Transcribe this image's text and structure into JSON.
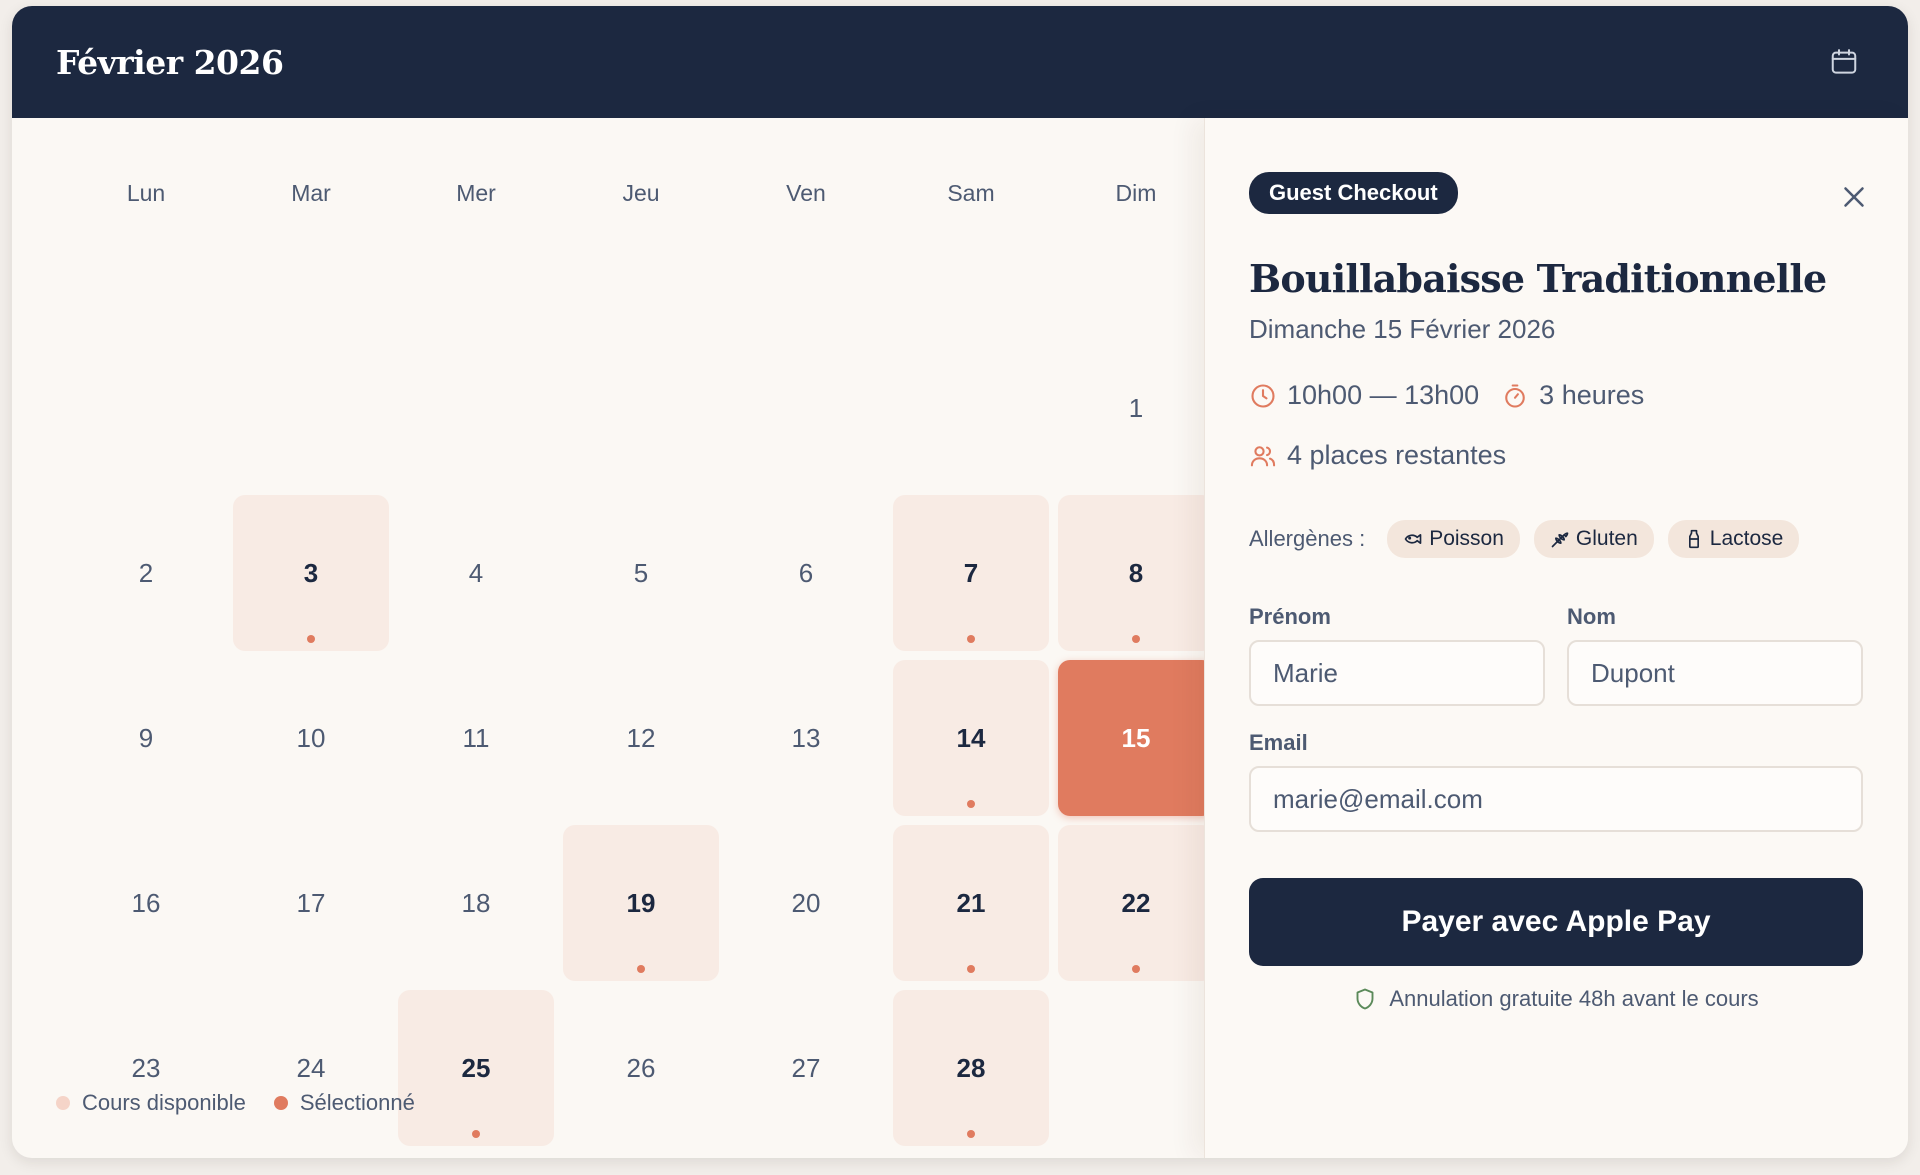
{
  "header": {
    "month_title": "Février 2026",
    "calendar_icon": "calendar-icon"
  },
  "calendar": {
    "weekdays": [
      "Lun",
      "Mar",
      "Mer",
      "Jeu",
      "Ven",
      "Sam",
      "Dim"
    ],
    "first_weekday_index": 6,
    "days_in_month": 28,
    "available_days": [
      3,
      7,
      8,
      14,
      19,
      21,
      22,
      25,
      28
    ],
    "selected_day": 15,
    "legend": {
      "available_label": "Cours disponible",
      "selected_label": "Sélectionné"
    }
  },
  "panel": {
    "badge": "Guest Checkout",
    "close_icon": "close-icon",
    "course_title": "Bouillabaisse Traditionnelle",
    "course_date": "Dimanche 15 Février 2026",
    "time_range": "10h00 — 13h00",
    "duration": "3 heures",
    "places": "4 places restantes",
    "allergens_label": "Allergènes :",
    "allergens": [
      {
        "label": "Poisson",
        "icon": "fish-icon"
      },
      {
        "label": "Gluten",
        "icon": "wheat-icon"
      },
      {
        "label": "Lactose",
        "icon": "milk-icon"
      }
    ],
    "form": {
      "first_name_label": "Prénom",
      "first_name_value": "Marie",
      "last_name_label": "Nom",
      "last_name_value": "Dupont",
      "email_label": "Email",
      "email_value": "marie@email.com"
    },
    "pay_button": "Payer avec Apple Pay",
    "cancellation_note": "Annulation gratuite 48h avant le cours"
  },
  "colors": {
    "navy": "#1c2840",
    "accent": "#e07b5f",
    "available_bg": "#f8ebe4",
    "legend_available": "#f5d4c8",
    "shield_green": "#5b8a5a"
  }
}
